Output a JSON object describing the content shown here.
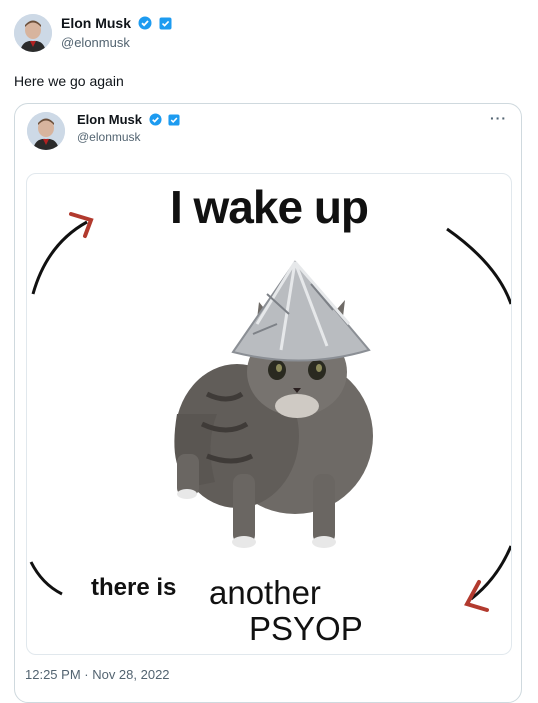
{
  "tweet": {
    "author_name": "Elon Musk",
    "author_handle": "@elonmusk",
    "text": "Here we go again"
  },
  "quoted_tweet": {
    "author_name": "Elon Musk",
    "author_handle": "@elonmusk",
    "more_label": "···",
    "timestamp": "12:25 PM · Nov 28, 2022",
    "meme": {
      "top_text": "I wake up",
      "bottom_text_1": "there is",
      "bottom_text_2": "another",
      "bottom_text_3": "PSYOP"
    }
  },
  "colors": {
    "verified_blue": "#1d9bf0",
    "text_primary": "#0f1419",
    "text_secondary": "#536471",
    "border": "#cfd9de",
    "arrow_red": "#b23a2e"
  },
  "icons": [
    "verified-badge-icon",
    "square-verified-icon",
    "more-icon",
    "arrow-icon"
  ]
}
